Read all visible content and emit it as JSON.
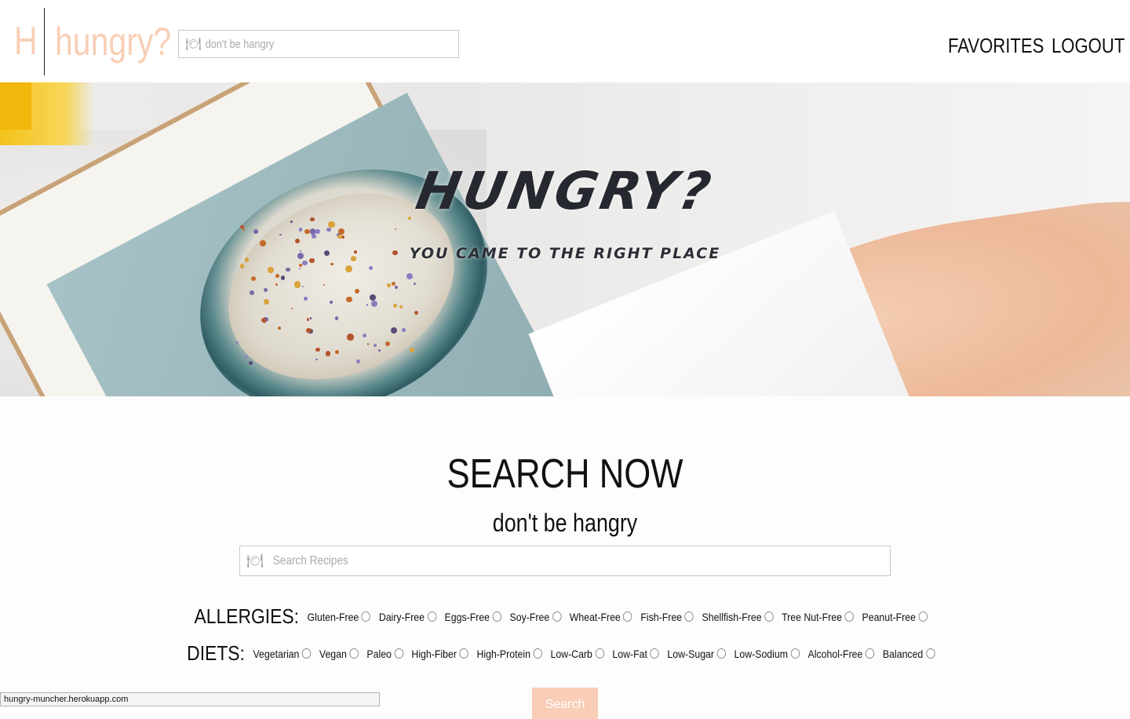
{
  "header": {
    "logo_letter": "H",
    "logo_text": "hungry?",
    "search_placeholder": "don't be hangry",
    "search_icon": "plate-icon",
    "nav": [
      {
        "label": "FAVORITES"
      },
      {
        "label": "LOGOUT"
      }
    ]
  },
  "hero": {
    "title": "HUNGRY?",
    "subtitle": "YOU CAME TO THE RIGHT PLACE"
  },
  "search": {
    "title": "SEARCH NOW",
    "subtitle": "don't be hangry",
    "placeholder": "Search Recipes",
    "button_label": "Search"
  },
  "allergies": {
    "label": "ALLERGIES:",
    "options": [
      "Gluten-Free",
      "Dairy-Free",
      "Eggs-Free",
      "Soy-Free",
      "Wheat-Free",
      "Fish-Free",
      "Shellfish-Free",
      "Tree Nut-Free",
      "Peanut-Free"
    ]
  },
  "diets": {
    "label": "DIETS:",
    "options": [
      "Vegetarian",
      "Vegan",
      "Paleo",
      "High-Fiber",
      "High-Protein",
      "Low-Carb",
      "Low-Fat",
      "Low-Sugar",
      "Low-Sodium",
      "Alcohol-Free",
      "Balanced"
    ]
  },
  "status_bar": {
    "url": "hungry-muncher.herokuapp.com"
  },
  "colors": {
    "accent": "#f8cfb6",
    "text": "#111111",
    "hero_text": "#262830"
  }
}
